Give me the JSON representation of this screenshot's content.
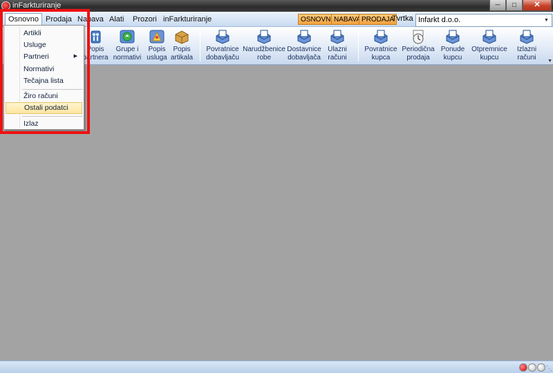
{
  "window": {
    "title": "inFarkturiranje"
  },
  "menu": {
    "items": [
      "Osnovno",
      "Prodaja",
      "Nabava",
      "Alati",
      "Prozori",
      "inFarkturiranje"
    ],
    "modes": [
      "OSNOVNO",
      "NABAVA",
      "PRODAJA"
    ],
    "company_label": "Tvrtka :",
    "company_value": "Infarkt d.o.o."
  },
  "toolbar": {
    "buttons": [
      {
        "line1": "Popis",
        "line2": "partnera",
        "icon": "people-icon"
      },
      {
        "line1": "Grupe i",
        "line2": "normativi",
        "icon": "recycle-icon"
      },
      {
        "line1": "Popis",
        "line2": "usluga",
        "icon": "services-icon"
      },
      {
        "line1": "Popis",
        "line2": "artikala",
        "icon": "box-icon"
      },
      {
        "line1": "Povratnice",
        "line2": "dobavljaču",
        "icon": "document-icon"
      },
      {
        "line1": "Narudžbenice",
        "line2": "robe",
        "icon": "document-icon"
      },
      {
        "line1": "Dostavnice",
        "line2": "dobavljača",
        "icon": "document-icon"
      },
      {
        "line1": "Ulazni",
        "line2": "računi",
        "icon": "document-icon"
      },
      {
        "line1": "Povratnice",
        "line2": "kupca",
        "icon": "document-icon"
      },
      {
        "line1": "Periodična",
        "line2": "prodaja",
        "icon": "clock-icon"
      },
      {
        "line1": "Ponude",
        "line2": "kupcu",
        "icon": "document-icon"
      },
      {
        "line1": "Otpremnice",
        "line2": "kupcu",
        "icon": "document-icon"
      },
      {
        "line1": "Izlazni",
        "line2": "računi",
        "icon": "document-icon"
      }
    ]
  },
  "dropdown": {
    "items": [
      "Artikli",
      "Usluge",
      "Partneri",
      "Normativi",
      "Tečajna lista",
      "Žiro računi",
      "Ostali podatci",
      "Izlaz"
    ],
    "highlighted": "Ostali podatci"
  },
  "colors": {
    "workspace": "#a3a3a3",
    "mode_button": "#f4a23e",
    "highlight_frame": "#ee1111"
  }
}
